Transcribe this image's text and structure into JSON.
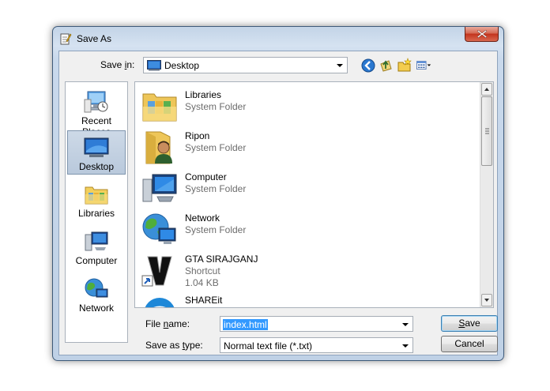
{
  "window": {
    "title": "Save As"
  },
  "save_in": {
    "label_pre": "Save ",
    "label_accel": "i",
    "label_post": "n:",
    "value": "Desktop"
  },
  "places": [
    {
      "label": "Recent Places",
      "icon": "recent-places-icon",
      "selected": false
    },
    {
      "label": "Desktop",
      "icon": "desktop-icon",
      "selected": true
    },
    {
      "label": "Libraries",
      "icon": "libraries-icon",
      "selected": false
    },
    {
      "label": "Computer",
      "icon": "computer-icon",
      "selected": false
    },
    {
      "label": "Network",
      "icon": "network-icon",
      "selected": false
    }
  ],
  "files": [
    {
      "name": "Libraries",
      "type": "System Folder",
      "icon": "libraries-folder-icon"
    },
    {
      "name": "Ripon",
      "type": "System Folder",
      "icon": "user-folder-icon"
    },
    {
      "name": "Computer",
      "type": "System Folder",
      "icon": "computer-icon"
    },
    {
      "name": "Network",
      "type": "System Folder",
      "icon": "network-icon"
    },
    {
      "name": "GTA SIRAJGANJ",
      "type": "Shortcut",
      "size": "1.04 KB",
      "icon": "gta-shortcut-icon"
    },
    {
      "name": "SHAREit",
      "type": "",
      "icon": "shareit-icon"
    }
  ],
  "file_name": {
    "label_pre": "File ",
    "label_accel": "n",
    "label_post": "ame:",
    "value": "index.html"
  },
  "save_as_type": {
    "label_pre": "Save as ",
    "label_accel": "t",
    "label_post": "ype:",
    "value": "Normal text file (*.txt)"
  },
  "buttons": {
    "save_accel": "S",
    "save_rest": "ave",
    "cancel": "Cancel"
  }
}
